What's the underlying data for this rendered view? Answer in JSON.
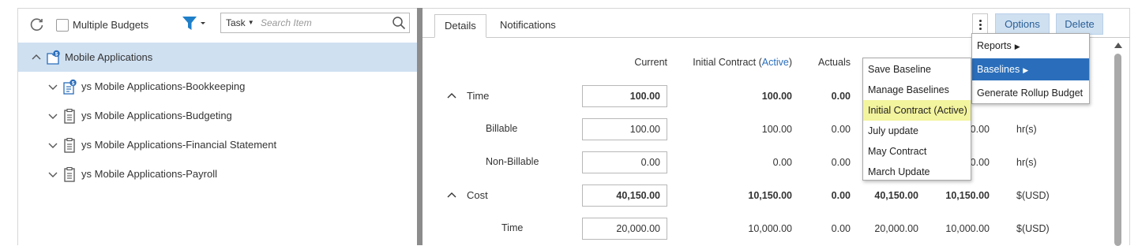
{
  "left_toolbar": {
    "multiple_budgets_label": "Multiple Budgets",
    "search_type": "Task",
    "search_placeholder": "Search Item"
  },
  "tree": {
    "items": [
      {
        "label": "Mobile Applications",
        "icon": "budget-icon",
        "expanded": true,
        "selected": true
      },
      {
        "label": "ys Mobile Applications-Bookkeeping",
        "icon": "budget-task-icon",
        "expanded": false
      },
      {
        "label": "ys Mobile Applications-Budgeting",
        "icon": "clipboard-icon",
        "expanded": false
      },
      {
        "label": "ys Mobile Applications-Financial Statement",
        "icon": "clipboard-icon",
        "expanded": false
      },
      {
        "label": "ys Mobile Applications-Payroll",
        "icon": "clipboard-icon",
        "expanded": false
      }
    ]
  },
  "tabs": [
    {
      "label": "Details",
      "active": true
    },
    {
      "label": "Notifications",
      "active": false
    }
  ],
  "actions": {
    "options_label": "Options",
    "delete_label": "Delete"
  },
  "columns": {
    "current": "Current",
    "initial_contract_prefix": "Initial Contract (",
    "initial_contract_active": "Active",
    "initial_contract_suffix": ")",
    "actuals": "Actuals"
  },
  "rows": [
    {
      "label": "Time",
      "major": true,
      "current": "100.00",
      "initial": "100.00",
      "actuals": "0.00",
      "c5": "",
      "c6": "",
      "unit": ""
    },
    {
      "label": "Billable",
      "major": false,
      "current": "100.00",
      "initial": "100.00",
      "actuals": "0.00",
      "c5": "",
      "c6": "0.00",
      "unit": "hr(s)"
    },
    {
      "label": "Non-Billable",
      "major": false,
      "current": "0.00",
      "initial": "0.00",
      "actuals": "0.00",
      "c5": "",
      "c6": "0.00",
      "unit": "hr(s)"
    },
    {
      "label": "Cost",
      "major": true,
      "current": "40,150.00",
      "initial": "10,150.00",
      "actuals": "0.00",
      "c5": "40,150.00",
      "c6": "10,150.00",
      "unit": "$(USD)"
    },
    {
      "label": "Time",
      "major": false,
      "current": "20,000.00",
      "initial": "10,000.00",
      "actuals": "0.00",
      "c5": "20,000.00",
      "c6": "10,000.00",
      "unit": "$(USD)"
    }
  ],
  "menu": {
    "items": [
      {
        "label": "Reports",
        "has_submenu": true,
        "highlighted": false
      },
      {
        "label": "Baselines",
        "has_submenu": true,
        "highlighted": true
      },
      {
        "label": "Generate Rollup Budget",
        "has_submenu": false,
        "highlighted": false
      }
    ]
  },
  "baselines_menu": {
    "items": [
      {
        "label": "Save Baseline",
        "highlighted": false
      },
      {
        "label": "Manage Baselines",
        "highlighted": false
      },
      {
        "label": "Initial Contract (Active)",
        "highlighted": true
      },
      {
        "label": "July update",
        "highlighted": false
      },
      {
        "label": "May Contract",
        "highlighted": false
      },
      {
        "label": "March Update",
        "highlighted": false
      }
    ]
  },
  "colors": {
    "accent": "#2a6ebb",
    "selected_row": "#cfe0f1",
    "button_bg": "#cfe0f1",
    "highlight_yellow": "#f3f49e"
  }
}
